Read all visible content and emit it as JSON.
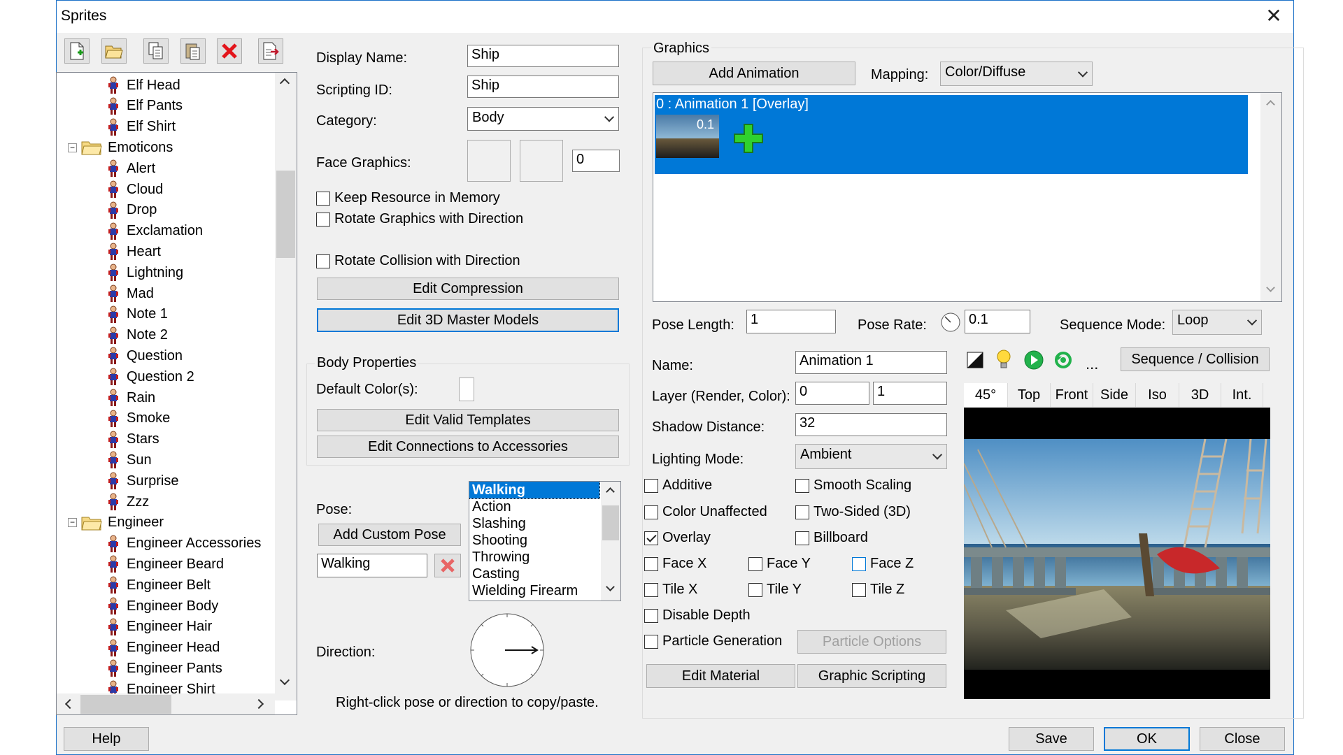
{
  "window": {
    "title": "Sprites",
    "close_glyph": "✕"
  },
  "toolbar": {
    "icons": [
      "new-icon",
      "open-folder-icon",
      "copy-icon",
      "paste-icon",
      "delete-icon",
      "export-icon"
    ]
  },
  "tree": {
    "rows": [
      {
        "label": "Elf Head",
        "type": "sprite"
      },
      {
        "label": "Elf Pants",
        "type": "sprite"
      },
      {
        "label": "Elf Shirt",
        "type": "sprite"
      },
      {
        "label": "Emoticons",
        "type": "folder"
      },
      {
        "label": "Alert",
        "type": "sprite"
      },
      {
        "label": "Cloud",
        "type": "sprite"
      },
      {
        "label": "Drop",
        "type": "sprite"
      },
      {
        "label": "Exclamation",
        "type": "sprite"
      },
      {
        "label": "Heart",
        "type": "sprite"
      },
      {
        "label": "Lightning",
        "type": "sprite"
      },
      {
        "label": "Mad",
        "type": "sprite"
      },
      {
        "label": "Note 1",
        "type": "sprite"
      },
      {
        "label": "Note 2",
        "type": "sprite"
      },
      {
        "label": "Question",
        "type": "sprite"
      },
      {
        "label": "Question 2",
        "type": "sprite"
      },
      {
        "label": "Rain",
        "type": "sprite"
      },
      {
        "label": "Smoke",
        "type": "sprite"
      },
      {
        "label": "Stars",
        "type": "sprite"
      },
      {
        "label": "Sun",
        "type": "sprite"
      },
      {
        "label": "Surprise",
        "type": "sprite"
      },
      {
        "label": "Zzz",
        "type": "sprite"
      },
      {
        "label": "Engineer",
        "type": "folder"
      },
      {
        "label": "Engineer Accessories",
        "type": "sprite"
      },
      {
        "label": "Engineer Beard",
        "type": "sprite"
      },
      {
        "label": "Engineer Belt",
        "type": "sprite"
      },
      {
        "label": "Engineer Body",
        "type": "sprite"
      },
      {
        "label": "Engineer Hair",
        "type": "sprite"
      },
      {
        "label": "Engineer Head",
        "type": "sprite"
      },
      {
        "label": "Engineer Pants",
        "type": "sprite"
      },
      {
        "label": "Engineer Shirt",
        "type": "sprite"
      }
    ],
    "expander_glyph": "−"
  },
  "props": {
    "display_name_label": "Display Name:",
    "display_name": "Ship",
    "scripting_id_label": "Scripting ID:",
    "scripting_id": "Ship",
    "category_label": "Category:",
    "category": "Body",
    "face_graphics_label": "Face Graphics:",
    "face_graphics_value": "0",
    "keep_resource": "Keep Resource in Memory",
    "rotate_graphics": "Rotate Graphics with Direction",
    "rotate_collision": "Rotate Collision with Direction",
    "edit_compression": "Edit Compression",
    "edit_3d_master": "Edit 3D Master Models"
  },
  "body_props": {
    "title": "Body Properties",
    "default_colors_label": "Default Color(s):",
    "edit_valid_templates": "Edit Valid Templates",
    "edit_connections": "Edit Connections to Accessories"
  },
  "pose": {
    "label": "Pose:",
    "add_custom": "Add Custom Pose",
    "current": "Walking",
    "list": [
      "Walking",
      "Action",
      "Slashing",
      "Shooting",
      "Throwing",
      "Casting",
      "Wielding Firearm"
    ],
    "direction_label": "Direction:",
    "hint": "Right-click pose or direction to copy/paste."
  },
  "graphics": {
    "title": "Graphics",
    "add_animation": "Add Animation",
    "mapping_label": "Mapping:",
    "mapping": "Color/Diffuse",
    "animation_item": "0 : Animation 1 [Overlay]",
    "frame_label": "0.1",
    "pose_length_label": "Pose Length:",
    "pose_length": "1",
    "pose_rate_label": "Pose Rate:",
    "pose_rate": "0.1",
    "sequence_mode_label": "Sequence Mode:",
    "sequence_mode": "Loop",
    "name_label": "Name:",
    "name": "Animation 1",
    "layer_label": "Layer (Render, Color):",
    "layer_render": "0",
    "layer_color": "1",
    "shadow_label": "Shadow Distance:",
    "shadow": "32",
    "lighting_label": "Lighting Mode:",
    "lighting": "Ambient",
    "checks": {
      "additive": "Additive",
      "smooth_scaling": "Smooth Scaling",
      "color_unaffected": "Color Unaffected",
      "two_sided": "Two-Sided (3D)",
      "overlay": "Overlay",
      "billboard": "Billboard",
      "face_x": "Face X",
      "face_y": "Face Y",
      "face_z": "Face Z",
      "tile_x": "Tile X",
      "tile_y": "Tile Y",
      "tile_z": "Tile Z",
      "disable_depth": "Disable Depth",
      "particle_generation": "Particle Generation"
    },
    "particle_options": "Particle Options",
    "edit_material": "Edit Material",
    "graphic_scripting": "Graphic Scripting",
    "sequence_collision": "Sequence / Collision",
    "ellipsis": "...",
    "tabs": [
      "45°",
      "Top",
      "Front",
      "Side",
      "Iso",
      "3D",
      "Int."
    ]
  },
  "footer": {
    "help": "Help",
    "save": "Save",
    "ok": "OK",
    "close": "Close"
  },
  "colors": {
    "accent": "#0078d7",
    "selection": "#0078d7",
    "window_bg": "#f0f0f0"
  }
}
